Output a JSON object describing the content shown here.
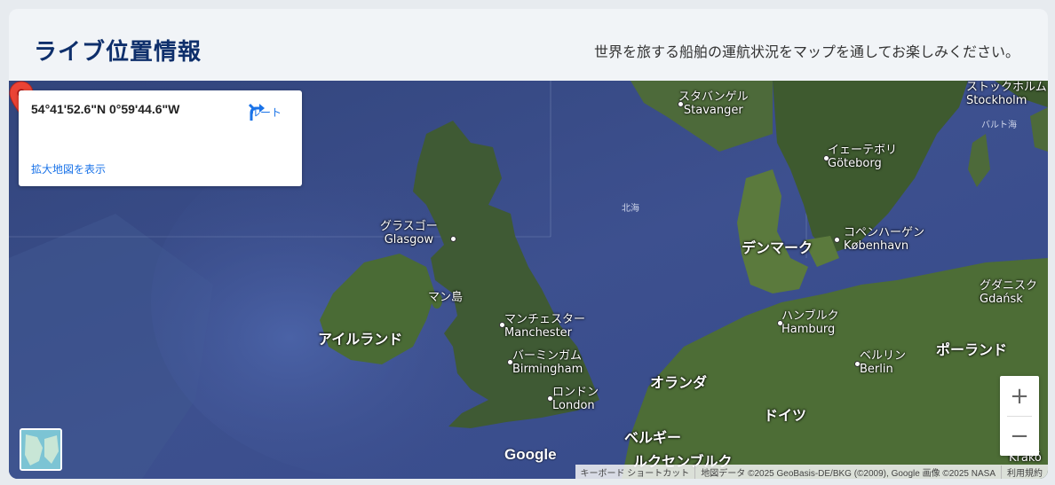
{
  "header": {
    "title": "ライブ位置情報",
    "subtitle": "世界を旅する船舶の運航状況をマップを通してお楽しみください。"
  },
  "infobox": {
    "coords": "54°41'52.6\"N 0°59'44.6\"W",
    "route_label": "ルート",
    "enlarge_link": "拡大地図を表示"
  },
  "map_labels": {
    "stavanger": "スタバンゲル\nStavanger",
    "stockholm": "ストックホルム\nStockholm",
    "baltic": "バルト海",
    "goteborg": "イェーテボリ\nGöteborg",
    "north_sea": "北海",
    "glasgow": "グラスゴー\nGlasgow",
    "denmark": "デンマーク",
    "copenhagen": "コペンハーゲン\nKøbenhavn",
    "gdansk": "グダニスク\nGdańsk",
    "isle_of_man": "マン島",
    "manchester": "マンチェスター\nManchester",
    "hamburg": "ハンブルク\nHamburg",
    "ireland": "アイルランド",
    "birmingham": "バーミンガム\nBirmingham",
    "berlin": "ベルリン\nBerlin",
    "poland": "ポーランド",
    "london": "ロンドン\nLondon",
    "netherlands": "オランダ",
    "germany": "ドイツ",
    "belgium": "ベルギー",
    "luxembourg": "ルクセンブルク",
    "krakow": "Krakó"
  },
  "zoom": {
    "in": "+",
    "out": "−"
  },
  "google_logo": "Google",
  "attribution": {
    "shortcuts": "キーボード ショートカット",
    "data": "地図データ ©2025 GeoBasis-DE/BKG (©2009), Google 画像 ©2025 NASA",
    "terms": "利用規約"
  },
  "colors": {
    "title": "#0e2f6b",
    "link": "#1a73e8",
    "pin": "#ea4335",
    "sea": "#3c4f8e",
    "land": "#3f5a34"
  }
}
